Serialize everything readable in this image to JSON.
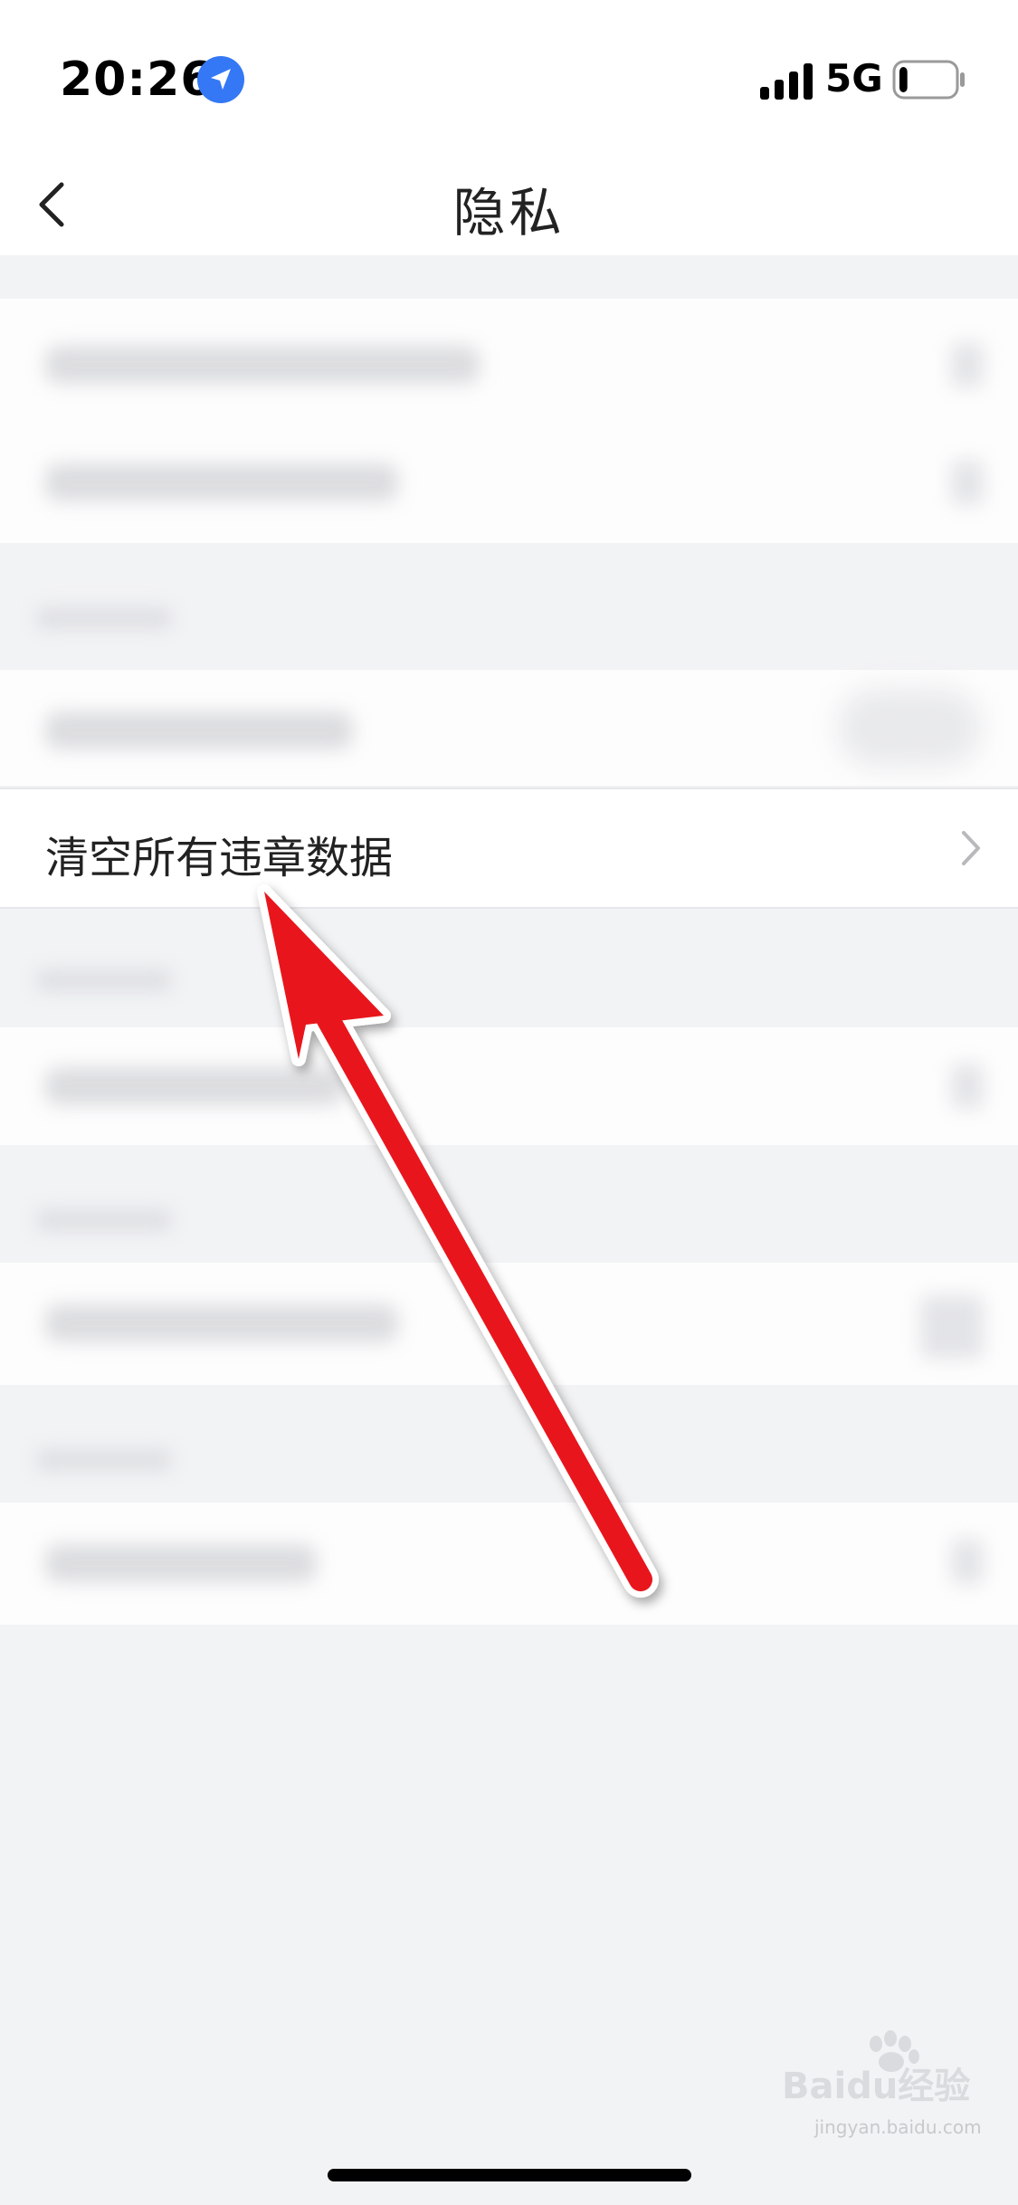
{
  "status_bar": {
    "time": "20:26",
    "network": "5G",
    "battery_level": 0.15
  },
  "nav": {
    "title": "隐私",
    "back_icon": "chevron-left-icon"
  },
  "list": {
    "highlighted_item": {
      "label": "清空所有违章数据",
      "icon": "chevron-right-icon"
    }
  },
  "watermark": {
    "brand": "Baidu经验",
    "sub": "jingyan.baidu.com"
  },
  "colors": {
    "arrow": "#e8141e",
    "location_badge": "#3478f6",
    "background": "#f2f3f5"
  }
}
